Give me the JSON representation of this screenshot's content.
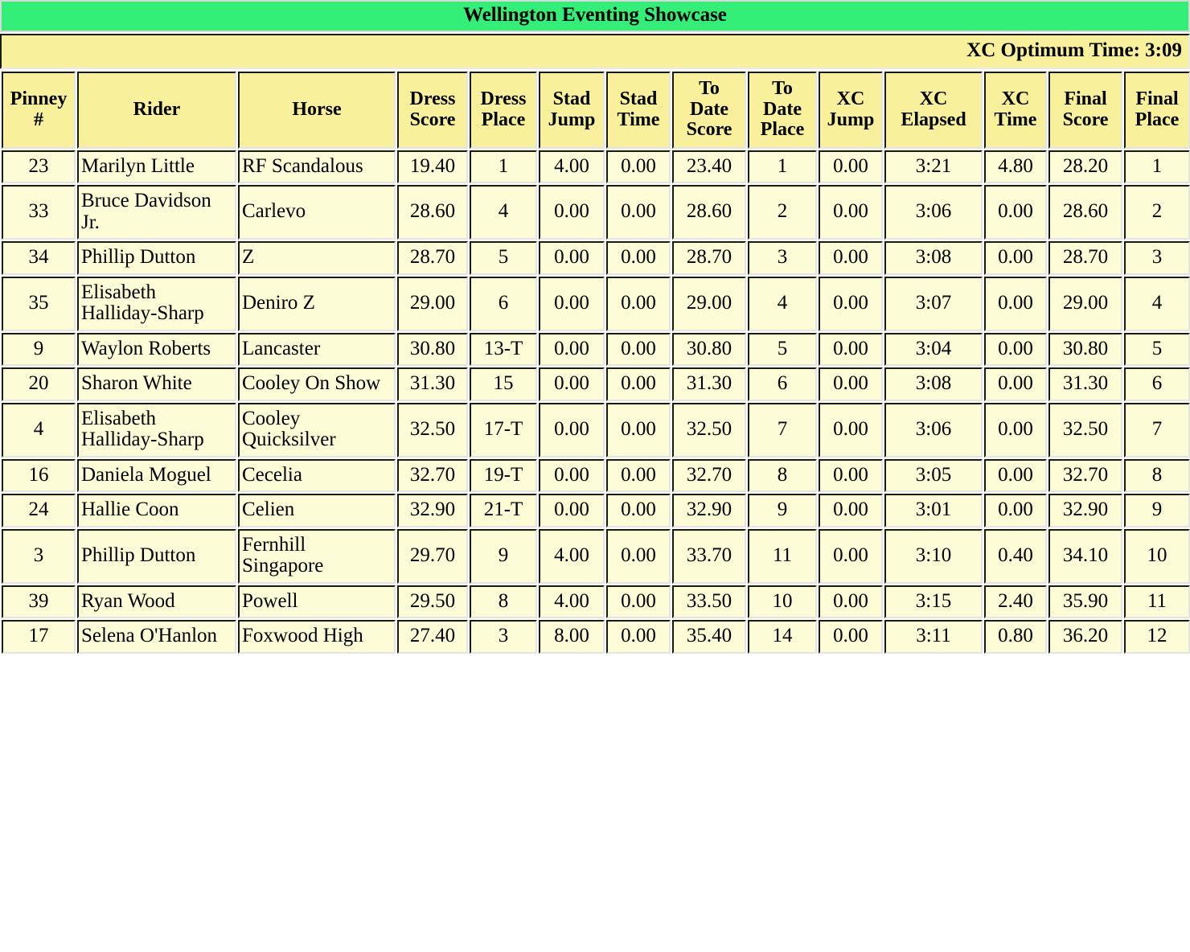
{
  "banner": {
    "title": "Wellington Eventing Showcase"
  },
  "optimum_bar": {
    "text": "XC Optimum Time: 3:09"
  },
  "table": {
    "headers": [
      "Pinney #",
      "Rider",
      "Horse",
      "Dress Score",
      "Dress Place",
      "Stad Jump",
      "Stad Time",
      "To Date Score",
      "To Date Place",
      "XC Jump",
      "XC Elapsed",
      "XC Time",
      "Final Score",
      "Final Place"
    ],
    "header_lines": [
      [
        "Pinney",
        "#"
      ],
      [
        "Rider"
      ],
      [
        "Horse"
      ],
      [
        "Dress",
        "Score"
      ],
      [
        "Dress",
        "Place"
      ],
      [
        "Stad",
        "Jump"
      ],
      [
        "Stad",
        "Time"
      ],
      [
        "To",
        "Date",
        "Score"
      ],
      [
        "To",
        "Date",
        "Place"
      ],
      [
        "XC",
        "Jump"
      ],
      [
        "XC",
        "Elapsed"
      ],
      [
        "XC",
        "Time"
      ],
      [
        "Final",
        "Score"
      ],
      [
        "Final",
        "Place"
      ]
    ],
    "rows": [
      {
        "pinney": "23",
        "rider": "Marilyn Little",
        "horse": "RF Scandalous",
        "dress_score": "19.40",
        "dress_place": "1",
        "stad_jump": "4.00",
        "stad_time": "0.00",
        "to_date_score": "23.40",
        "to_date_place": "1",
        "xc_jump": "0.00",
        "xc_elapsed": "3:21",
        "xc_time": "4.80",
        "final_score": "28.20",
        "final_place": "1"
      },
      {
        "pinney": "33",
        "rider": "Bruce Davidson Jr.",
        "horse": "Carlevo",
        "dress_score": "28.60",
        "dress_place": "4",
        "stad_jump": "0.00",
        "stad_time": "0.00",
        "to_date_score": "28.60",
        "to_date_place": "2",
        "xc_jump": "0.00",
        "xc_elapsed": "3:06",
        "xc_time": "0.00",
        "final_score": "28.60",
        "final_place": "2"
      },
      {
        "pinney": "34",
        "rider": "Phillip Dutton",
        "horse": "Z",
        "dress_score": "28.70",
        "dress_place": "5",
        "stad_jump": "0.00",
        "stad_time": "0.00",
        "to_date_score": "28.70",
        "to_date_place": "3",
        "xc_jump": "0.00",
        "xc_elapsed": "3:08",
        "xc_time": "0.00",
        "final_score": "28.70",
        "final_place": "3"
      },
      {
        "pinney": "35",
        "rider": "Elisabeth Halliday-Sharp",
        "horse": "Deniro Z",
        "dress_score": "29.00",
        "dress_place": "6",
        "stad_jump": "0.00",
        "stad_time": "0.00",
        "to_date_score": "29.00",
        "to_date_place": "4",
        "xc_jump": "0.00",
        "xc_elapsed": "3:07",
        "xc_time": "0.00",
        "final_score": "29.00",
        "final_place": "4"
      },
      {
        "pinney": "9",
        "rider": "Waylon Roberts",
        "horse": "Lancaster",
        "dress_score": "30.80",
        "dress_place": "13-T",
        "stad_jump": "0.00",
        "stad_time": "0.00",
        "to_date_score": "30.80",
        "to_date_place": "5",
        "xc_jump": "0.00",
        "xc_elapsed": "3:04",
        "xc_time": "0.00",
        "final_score": "30.80",
        "final_place": "5"
      },
      {
        "pinney": "20",
        "rider": "Sharon White",
        "horse": "Cooley On Show",
        "dress_score": "31.30",
        "dress_place": "15",
        "stad_jump": "0.00",
        "stad_time": "0.00",
        "to_date_score": "31.30",
        "to_date_place": "6",
        "xc_jump": "0.00",
        "xc_elapsed": "3:08",
        "xc_time": "0.00",
        "final_score": "31.30",
        "final_place": "6"
      },
      {
        "pinney": "4",
        "rider": "Elisabeth Halliday-Sharp",
        "horse": "Cooley Quicksilver",
        "dress_score": "32.50",
        "dress_place": "17-T",
        "stad_jump": "0.00",
        "stad_time": "0.00",
        "to_date_score": "32.50",
        "to_date_place": "7",
        "xc_jump": "0.00",
        "xc_elapsed": "3:06",
        "xc_time": "0.00",
        "final_score": "32.50",
        "final_place": "7"
      },
      {
        "pinney": "16",
        "rider": "Daniela Moguel",
        "horse": "Cecelia",
        "dress_score": "32.70",
        "dress_place": "19-T",
        "stad_jump": "0.00",
        "stad_time": "0.00",
        "to_date_score": "32.70",
        "to_date_place": "8",
        "xc_jump": "0.00",
        "xc_elapsed": "3:05",
        "xc_time": "0.00",
        "final_score": "32.70",
        "final_place": "8"
      },
      {
        "pinney": "24",
        "rider": "Hallie Coon",
        "horse": "Celien",
        "dress_score": "32.90",
        "dress_place": "21-T",
        "stad_jump": "0.00",
        "stad_time": "0.00",
        "to_date_score": "32.90",
        "to_date_place": "9",
        "xc_jump": "0.00",
        "xc_elapsed": "3:01",
        "xc_time": "0.00",
        "final_score": "32.90",
        "final_place": "9"
      },
      {
        "pinney": "3",
        "rider": "Phillip Dutton",
        "horse": "Fernhill Singapore",
        "dress_score": "29.70",
        "dress_place": "9",
        "stad_jump": "4.00",
        "stad_time": "0.00",
        "to_date_score": "33.70",
        "to_date_place": "11",
        "xc_jump": "0.00",
        "xc_elapsed": "3:10",
        "xc_time": "0.40",
        "final_score": "34.10",
        "final_place": "10"
      },
      {
        "pinney": "39",
        "rider": "Ryan Wood",
        "horse": "Powell",
        "dress_score": "29.50",
        "dress_place": "8",
        "stad_jump": "4.00",
        "stad_time": "0.00",
        "to_date_score": "33.50",
        "to_date_place": "10",
        "xc_jump": "0.00",
        "xc_elapsed": "3:15",
        "xc_time": "2.40",
        "final_score": "35.90",
        "final_place": "11"
      },
      {
        "pinney": "17",
        "rider": "Selena O'Hanlon",
        "horse": "Foxwood High",
        "dress_score": "27.40",
        "dress_place": "3",
        "stad_jump": "8.00",
        "stad_time": "0.00",
        "to_date_score": "35.40",
        "to_date_place": "14",
        "xc_jump": "0.00",
        "xc_elapsed": "3:11",
        "xc_time": "0.80",
        "final_score": "36.20",
        "final_place": "12"
      }
    ]
  },
  "colors": {
    "banner_green": "#33ee77",
    "header_yellow": "#f8f09a",
    "cell_yellow": "#fcfcd6",
    "text": "#000000"
  }
}
